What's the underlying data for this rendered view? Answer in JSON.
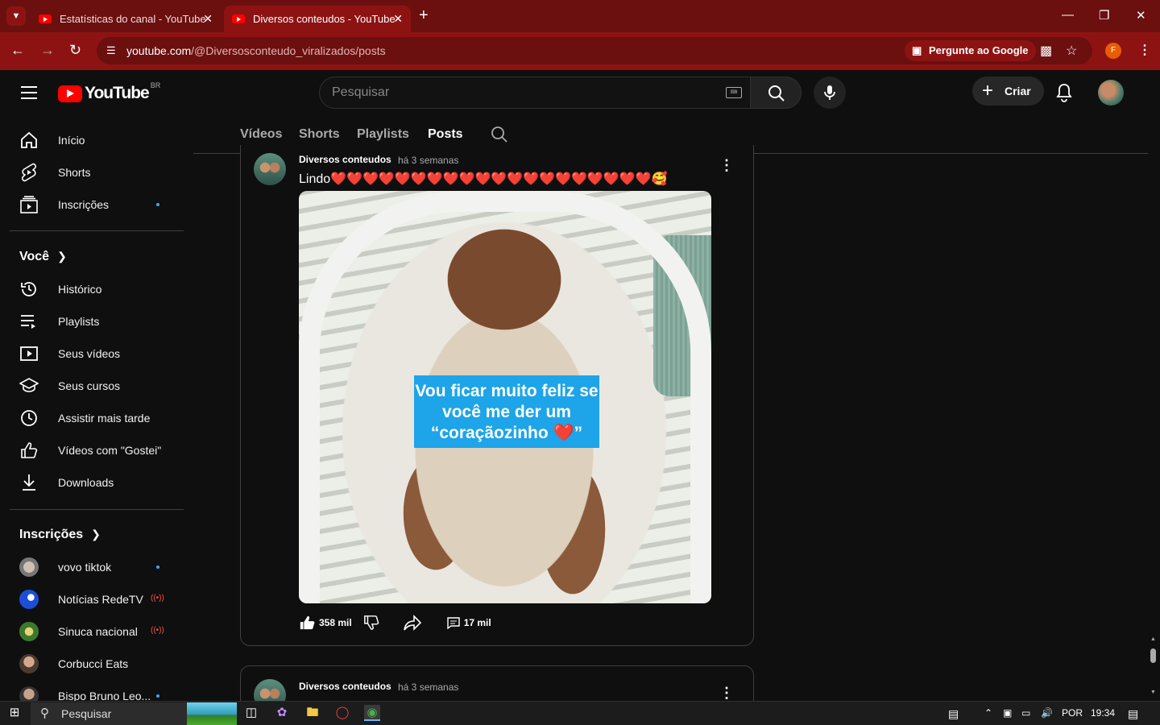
{
  "browser": {
    "tabs": [
      {
        "title": "Estatísticas do canal - YouTube",
        "active": false
      },
      {
        "title": "Diversos conteudos - YouTube",
        "active": true
      }
    ],
    "url_domain": "youtube.com",
    "url_path": "/@Diversosconteudo_viralizados/posts",
    "ask_google": "Pergunte ao Google",
    "profile_initial": "F"
  },
  "header": {
    "logo": "YouTube",
    "region": "BR",
    "search_placeholder": "Pesquisar",
    "create_label": "Criar"
  },
  "sidebar": {
    "main": [
      {
        "label": "Início",
        "icon": "home-icon"
      },
      {
        "label": "Shorts",
        "icon": "shorts-icon"
      },
      {
        "label": "Inscrições",
        "icon": "subscriptions-icon",
        "dot": true
      }
    ],
    "you_title": "Você",
    "you": [
      {
        "label": "Histórico",
        "icon": "history-icon"
      },
      {
        "label": "Playlists",
        "icon": "playlists-icon"
      },
      {
        "label": "Seus vídeos",
        "icon": "your-videos-icon"
      },
      {
        "label": "Seus cursos",
        "icon": "courses-icon"
      },
      {
        "label": "Assistir mais tarde",
        "icon": "watch-later-icon"
      },
      {
        "label": "Vídeos com \"Gostei\"",
        "icon": "liked-icon"
      },
      {
        "label": "Downloads",
        "icon": "download-icon"
      }
    ],
    "subs_title": "Inscrições",
    "subs": [
      {
        "label": "vovo tiktok",
        "badge": "dot",
        "color": "#8a8a8a"
      },
      {
        "label": "Notícias RedeTV",
        "badge": "live",
        "color": "#1d4ed8"
      },
      {
        "label": "Sinuca nacional",
        "badge": "live",
        "color": "#3b7a2a"
      },
      {
        "label": "Corbucci Eats",
        "badge": "",
        "color": "#6b4a3a"
      },
      {
        "label": "Bispo Bruno Leo...",
        "badge": "dot",
        "color": "#444444"
      }
    ]
  },
  "channel_tabs": [
    "Vídeos",
    "Shorts",
    "Playlists",
    "Posts"
  ],
  "active_tab": "Posts",
  "posts": [
    {
      "author": "Diversos conteudos",
      "time": "há 3 semanas",
      "text": "Lindo❤️❤️❤️❤️❤️❤️❤️❤️❤️❤️❤️❤️❤️❤️❤️❤️❤️❤️❤️❤️🥰",
      "image_caption": "Vou ficar muito feliz se você me der um “coraçãozinho ❤️”",
      "likes": "358 mil",
      "comments": "17 mil"
    },
    {
      "author": "Diversos conteudos",
      "time": "há 3 semanas"
    }
  ],
  "taskbar": {
    "search_placeholder": "Pesquisar",
    "language": "POR",
    "time": "19:34"
  }
}
